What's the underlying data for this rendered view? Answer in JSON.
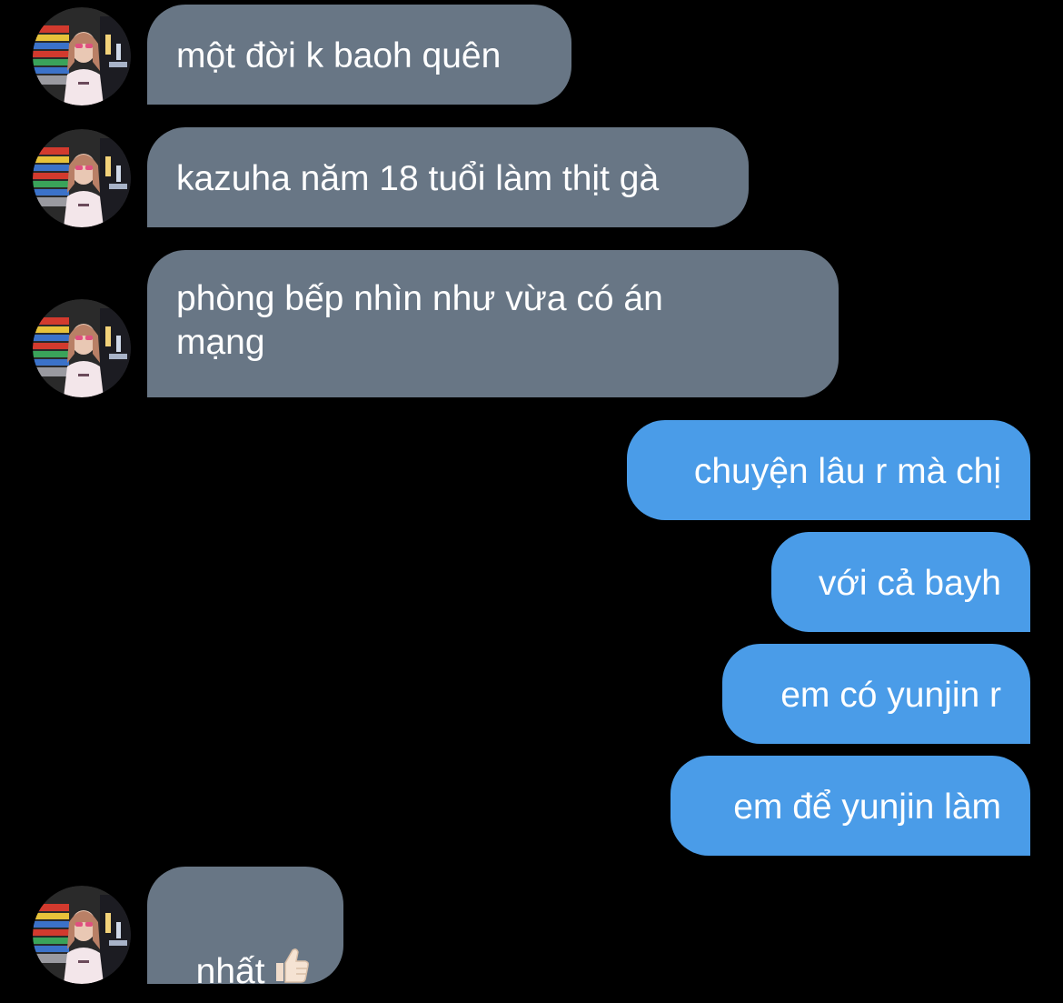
{
  "thread": {
    "messages": [
      {
        "sender": "contact",
        "text": "một đời k baoh quên"
      },
      {
        "sender": "contact",
        "text": "kazuha năm 18 tuổi làm thịt gà"
      },
      {
        "sender": "contact",
        "text": "phòng bếp nhìn như vừa có án\nmạng"
      },
      {
        "sender": "me",
        "text": "chuyện lâu r mà chị"
      },
      {
        "sender": "me",
        "text": "với cả bayh"
      },
      {
        "sender": "me",
        "text": "em có yunjin r"
      },
      {
        "sender": "me",
        "text": "em để yunjin làm"
      },
      {
        "sender": "contact",
        "text": "nhất",
        "emoji": "thumbs-up-icon"
      }
    ]
  },
  "colors": {
    "background": "#000000",
    "incoming_bubble": "#687685",
    "outgoing_bubble": "#4a9ce8",
    "text": "#ffffff"
  }
}
